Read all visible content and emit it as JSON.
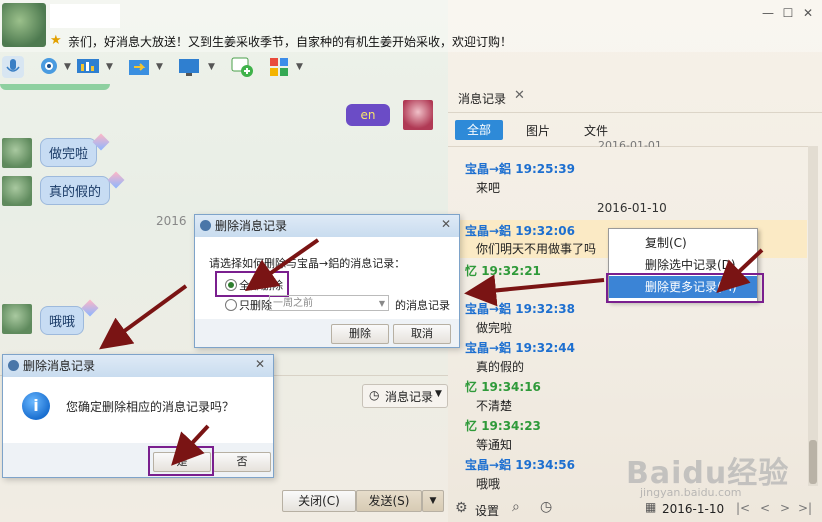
{
  "notice": "亲们，好消息大放送！又到生姜采收季节，自家种的有机生姜开始采收，欢迎订购！",
  "window_controls": {
    "min": "—",
    "max": "☐",
    "close": "✕"
  },
  "icons": [
    "mic-icon",
    "camera-icon",
    "screen-icon",
    "file-transfer-icon",
    "remote-icon",
    "chat-add-icon",
    "apps-icon"
  ],
  "chat": {
    "en_sticker": "en",
    "messages": [
      {
        "text": "做完啦"
      },
      {
        "text": "真的假的"
      },
      {
        "text": "哦哦"
      }
    ],
    "timestamp_fragment": "2016",
    "close_button": "关闭(C)",
    "send_button": "发送(S)",
    "history_button": "消息记录"
  },
  "history_panel": {
    "tab_label": "消息记录",
    "tab_close": "✕",
    "filters": [
      "全部",
      "图片",
      "文件"
    ],
    "date_top_fragment": "2016-01-01",
    "date_divider": "2016-01-10",
    "records": [
      {
        "sender": "宝晶→鋁",
        "time": "19:25:39",
        "body": "来吧",
        "color": "#1d6fd0"
      },
      {
        "sender": "宝晶→鋁",
        "time": "19:32:06",
        "body": "你们明天不用做事了吗",
        "color": "#1d6fd0"
      },
      {
        "sender": "忆",
        "time": "19:32:21",
        "body": "",
        "color": "#2f9a3a"
      },
      {
        "sender": "宝晶→鋁",
        "time": "19:32:38",
        "body": "做完啦",
        "color": "#1d6fd0"
      },
      {
        "sender": "宝晶→鋁",
        "time": "19:32:44",
        "body": "真的假的",
        "color": "#1d6fd0"
      },
      {
        "sender": "忆",
        "time": "19:34:16",
        "body": "不清楚",
        "color": "#2f9a3a"
      },
      {
        "sender": "忆",
        "time": "19:34:23",
        "body": "等通知",
        "color": "#2f9a3a"
      },
      {
        "sender": "宝晶→鋁",
        "time": "19:34:56",
        "body": "哦哦",
        "color": "#1d6fd0"
      }
    ],
    "context_menu": [
      "复制(C)",
      "删除选中记录(D)",
      "删除更多记录(M)"
    ],
    "settings_label": "设置",
    "date_picker_value": "2016-1-10",
    "nav": [
      "|<",
      "<",
      ">",
      ">|"
    ]
  },
  "delete_dialog": {
    "title": "删除消息记录",
    "prompt": "请选择如何删除与宝晶→鋁的消息记录：",
    "option_all": "全部删除",
    "option_only": "只删除",
    "only_range": "一周之前",
    "only_suffix": "的消息记录",
    "ok": "删除",
    "cancel": "取消"
  },
  "confirm_dialog": {
    "title": "删除消息记录",
    "message": "您确定删除相应的消息记录吗？",
    "yes": "是",
    "no": "否"
  },
  "watermark": {
    "main": "Baidu经验",
    "sub": "jingyan.baidu.com"
  }
}
